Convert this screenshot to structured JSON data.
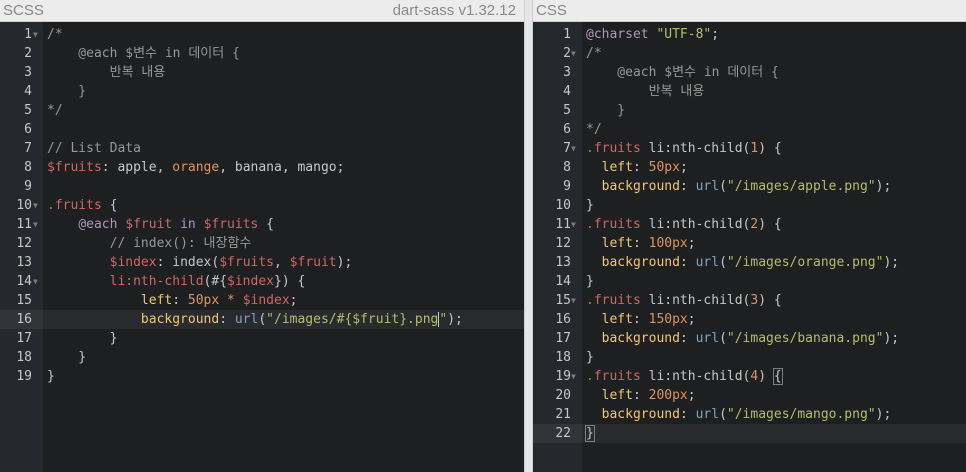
{
  "scss_pane": {
    "title": "SCSS",
    "version": "dart-sass v1.32.12",
    "line_numbers": [
      "1",
      "2",
      "3",
      "4",
      "5",
      "6",
      "7",
      "8",
      "9",
      "10",
      "11",
      "12",
      "13",
      "14",
      "15",
      "16",
      "17",
      "18",
      "19"
    ]
  },
  "css_pane": {
    "title": "CSS",
    "line_numbers": [
      "1",
      "2",
      "3",
      "4",
      "5",
      "6",
      "7",
      "8",
      "9",
      "10",
      "11",
      "12",
      "13",
      "14",
      "15",
      "16",
      "17",
      "18",
      "19",
      "20",
      "21",
      "22"
    ]
  },
  "scss_code": [
    [
      [
        "c",
        "/*"
      ]
    ],
    [
      [
        "c",
        "    @each $변수 in 데이터 {"
      ]
    ],
    [
      [
        "c",
        "        반복 내용"
      ]
    ],
    [
      [
        "c",
        "    }"
      ]
    ],
    [
      [
        "c",
        "*/"
      ]
    ],
    [],
    [
      [
        "c",
        "// List Data"
      ]
    ],
    [
      [
        "v",
        "$fruits"
      ],
      [
        "t",
        ": apple, "
      ],
      [
        "n",
        "orange"
      ],
      [
        "t",
        ", banana, mango;"
      ]
    ],
    [],
    [
      [
        "sel",
        ".fruits"
      ],
      [
        "t",
        " {"
      ]
    ],
    [
      [
        "t",
        "    "
      ],
      [
        "k",
        "@each"
      ],
      [
        "t",
        " "
      ],
      [
        "v",
        "$fruit"
      ],
      [
        "t",
        " "
      ],
      [
        "k",
        "in"
      ],
      [
        "t",
        " "
      ],
      [
        "v",
        "$fruits"
      ],
      [
        "t",
        " {"
      ]
    ],
    [
      [
        "t",
        "        "
      ],
      [
        "c",
        "// index(): 내장함수"
      ]
    ],
    [
      [
        "t",
        "        "
      ],
      [
        "v",
        "$index"
      ],
      [
        "t",
        ": index("
      ],
      [
        "v",
        "$fruits"
      ],
      [
        "t",
        ", "
      ],
      [
        "v",
        "$fruit"
      ],
      [
        "t",
        ");"
      ]
    ],
    [
      [
        "t",
        "        "
      ],
      [
        "sel",
        "li:nth-child"
      ],
      [
        "t",
        "(#{"
      ],
      [
        "v",
        "$index"
      ],
      [
        "t",
        "}) {"
      ]
    ],
    [
      [
        "t",
        "            "
      ],
      [
        "p",
        "left"
      ],
      [
        "t",
        ": "
      ],
      [
        "n",
        "50px"
      ],
      [
        "t",
        " "
      ],
      [
        "n",
        "*"
      ],
      [
        "t",
        " "
      ],
      [
        "v",
        "$index"
      ],
      [
        "t",
        ";"
      ]
    ],
    [
      [
        "t",
        "            "
      ],
      [
        "p",
        "background"
      ],
      [
        "t",
        ": "
      ],
      [
        "f",
        "url"
      ],
      [
        "t",
        "("
      ],
      [
        "s",
        "\"/images/#{$fruit}.png"
      ],
      [
        "cur",
        ""
      ],
      [
        "s",
        "\""
      ],
      [
        "t",
        ");"
      ]
    ],
    [
      [
        "t",
        "        }"
      ]
    ],
    [
      [
        "t",
        "    }"
      ]
    ],
    [
      [
        "t",
        "}"
      ]
    ]
  ],
  "css_code": [
    [
      [
        "at",
        "@charset"
      ],
      [
        "t",
        " "
      ],
      [
        "s",
        "\"UTF-8\""
      ],
      [
        "t",
        ";"
      ]
    ],
    [
      [
        "c",
        "/*"
      ]
    ],
    [
      [
        "c",
        "    @each $변수 in 데이터 {"
      ]
    ],
    [
      [
        "c",
        "        반복 내용"
      ]
    ],
    [
      [
        "c",
        "    }"
      ]
    ],
    [
      [
        "c",
        "*/"
      ]
    ],
    [
      [
        "sel",
        ".fruits"
      ],
      [
        "t",
        " li:nth-child("
      ],
      [
        "n",
        "1"
      ],
      [
        "t",
        ") {"
      ]
    ],
    [
      [
        "t",
        "  "
      ],
      [
        "p",
        "left"
      ],
      [
        "t",
        ": "
      ],
      [
        "n",
        "50px"
      ],
      [
        "t",
        ";"
      ]
    ],
    [
      [
        "t",
        "  "
      ],
      [
        "p",
        "background"
      ],
      [
        "t",
        ": "
      ],
      [
        "f",
        "url"
      ],
      [
        "t",
        "("
      ],
      [
        "s",
        "\"/images/apple.png\""
      ],
      [
        "t",
        ");"
      ]
    ],
    [
      [
        "t",
        "}"
      ]
    ],
    [
      [
        "sel",
        ".fruits"
      ],
      [
        "t",
        " li:nth-child("
      ],
      [
        "n",
        "2"
      ],
      [
        "t",
        ") {"
      ]
    ],
    [
      [
        "t",
        "  "
      ],
      [
        "p",
        "left"
      ],
      [
        "t",
        ": "
      ],
      [
        "n",
        "100px"
      ],
      [
        "t",
        ";"
      ]
    ],
    [
      [
        "t",
        "  "
      ],
      [
        "p",
        "background"
      ],
      [
        "t",
        ": "
      ],
      [
        "f",
        "url"
      ],
      [
        "t",
        "("
      ],
      [
        "s",
        "\"/images/orange.png\""
      ],
      [
        "t",
        ");"
      ]
    ],
    [
      [
        "t",
        "}"
      ]
    ],
    [
      [
        "sel",
        ".fruits"
      ],
      [
        "t",
        " li:nth-child("
      ],
      [
        "n",
        "3"
      ],
      [
        "t",
        ") {"
      ]
    ],
    [
      [
        "t",
        "  "
      ],
      [
        "p",
        "left"
      ],
      [
        "t",
        ": "
      ],
      [
        "n",
        "150px"
      ],
      [
        "t",
        ";"
      ]
    ],
    [
      [
        "t",
        "  "
      ],
      [
        "p",
        "background"
      ],
      [
        "t",
        ": "
      ],
      [
        "f",
        "url"
      ],
      [
        "t",
        "("
      ],
      [
        "s",
        "\"/images/banana.png\""
      ],
      [
        "t",
        ");"
      ]
    ],
    [
      [
        "t",
        "}"
      ]
    ],
    [
      [
        "sel",
        ".fruits"
      ],
      [
        "t",
        " li:nth-child("
      ],
      [
        "n",
        "4"
      ],
      [
        "t",
        ") "
      ],
      [
        "br",
        "{"
      ]
    ],
    [
      [
        "t",
        "  "
      ],
      [
        "p",
        "left"
      ],
      [
        "t",
        ": "
      ],
      [
        "n",
        "200px"
      ],
      [
        "t",
        ";"
      ]
    ],
    [
      [
        "t",
        "  "
      ],
      [
        "p",
        "background"
      ],
      [
        "t",
        ": "
      ],
      [
        "f",
        "url"
      ],
      [
        "t",
        "("
      ],
      [
        "s",
        "\"/images/mango.png\""
      ],
      [
        "t",
        ");"
      ]
    ],
    [
      [
        "br",
        "}"
      ],
      [
        "cur",
        ""
      ]
    ]
  ],
  "scss_folds": [
    "1",
    "10",
    "11",
    "14"
  ],
  "css_folds": [
    "2",
    "7",
    "11",
    "15",
    "19"
  ],
  "scss_active_line": "16",
  "css_active_line": "22"
}
